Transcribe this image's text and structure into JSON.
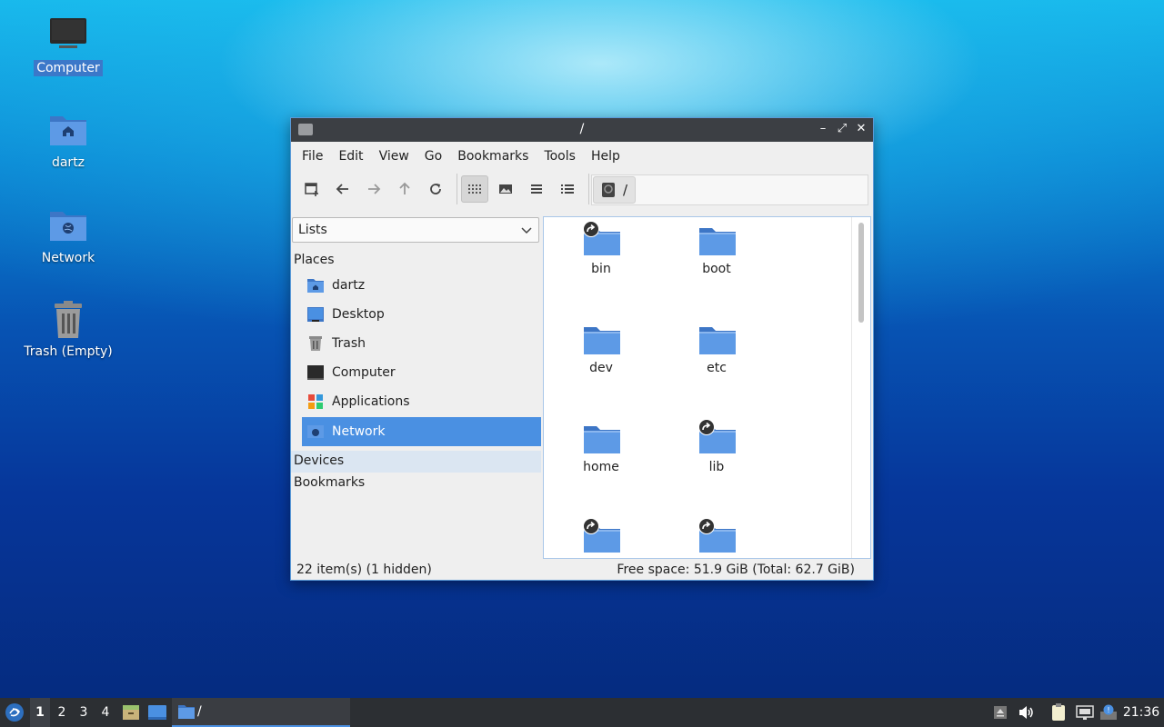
{
  "desktop": {
    "icons": [
      {
        "label": "Computer",
        "icon": "computer-icon",
        "selected": true
      },
      {
        "label": "dartz",
        "icon": "home-folder-icon"
      },
      {
        "label": "Network",
        "icon": "network-folder-icon"
      },
      {
        "label": "Trash (Empty)",
        "icon": "trash-icon"
      }
    ]
  },
  "window": {
    "title": "/",
    "controls": {
      "minimize": "–",
      "maximize": "⤢",
      "close": "✕"
    },
    "menu": [
      "File",
      "Edit",
      "View",
      "Go",
      "Bookmarks",
      "Tools",
      "Help"
    ],
    "toolbar": {
      "buttons": [
        "new-tab-icon",
        "back-icon",
        "forward-icon",
        "up-icon",
        "reload-icon",
        "icon-view-icon",
        "thumbnail-view-icon",
        "compact-view-icon",
        "detailed-list-view-icon"
      ],
      "active_view": "icon-view-icon"
    },
    "path": "/",
    "sidebar": {
      "mode": "Lists",
      "places_header": "Places",
      "places": [
        {
          "label": "dartz",
          "icon": "home-folder-icon"
        },
        {
          "label": "Desktop",
          "icon": "desktop-icon"
        },
        {
          "label": "Trash",
          "icon": "trash-icon"
        },
        {
          "label": "Computer",
          "icon": "computer-icon"
        },
        {
          "label": "Applications",
          "icon": "applications-icon"
        },
        {
          "label": "Network",
          "icon": "network-icon",
          "selected": true
        }
      ],
      "devices_header": "Devices",
      "bookmarks_header": "Bookmarks"
    },
    "files": [
      {
        "name": "bin",
        "symlink": true
      },
      {
        "name": "boot",
        "symlink": false
      },
      {
        "name": "dev",
        "symlink": false
      },
      {
        "name": "etc",
        "symlink": false
      },
      {
        "name": "home",
        "symlink": false
      },
      {
        "name": "lib",
        "symlink": true
      },
      {
        "name": "",
        "symlink": true
      },
      {
        "name": "",
        "symlink": true
      }
    ],
    "status": {
      "items": "22 item(s) (1 hidden)",
      "free_space": "Free space: 51.9 GiB (Total: 62.7 GiB)"
    }
  },
  "taskbar": {
    "workspaces": [
      "1",
      "2",
      "3",
      "4"
    ],
    "current_workspace": "1",
    "task_label": "/",
    "clock": "21:36"
  },
  "colors": {
    "accent": "#4a90e2",
    "folder": "#4a86d6",
    "titlebar": "#3c3f44",
    "taskbar": "#2c2f33"
  }
}
